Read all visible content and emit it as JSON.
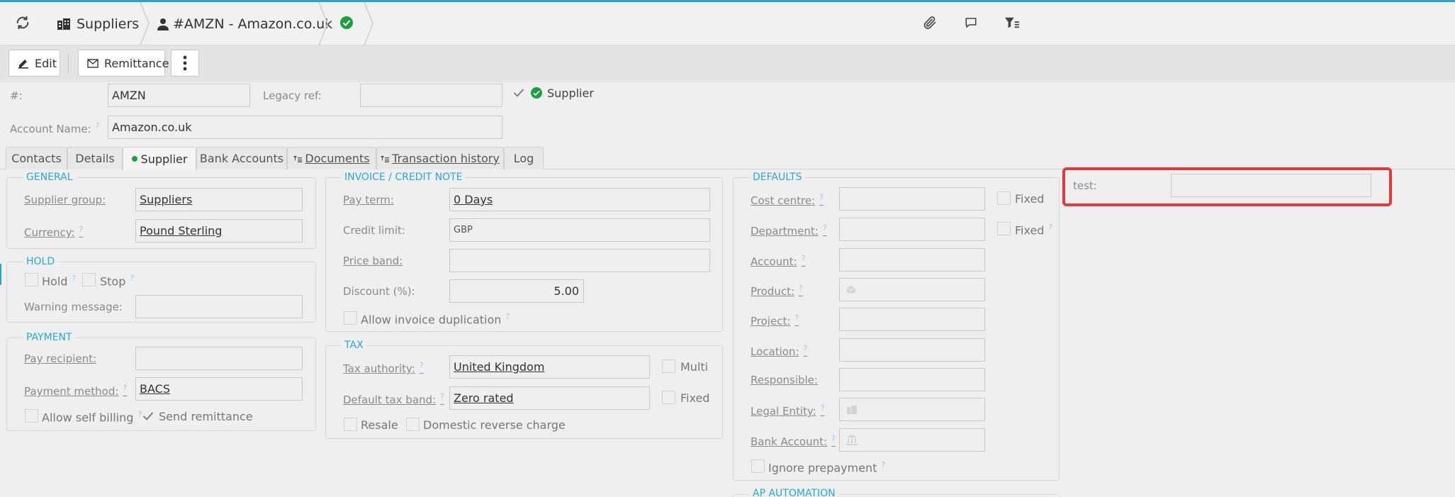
{
  "topbar": {
    "suppliers_label": "Suppliers",
    "record_label": "#AMZN - Amazon.co.uk"
  },
  "toolbar": {
    "edit_label": "Edit",
    "remittance_label": "Remittance"
  },
  "header": {
    "number_label": "#:",
    "number_value": "AMZN",
    "legacy_ref_label": "Legacy ref:",
    "legacy_ref_value": "",
    "supplier_check_label": "Supplier",
    "account_name_label": "Account Name:",
    "account_name_value": "Amazon.co.uk",
    "help_mark": "?"
  },
  "tabs": [
    {
      "label": "Contacts"
    },
    {
      "label": "Details"
    },
    {
      "label": "Supplier"
    },
    {
      "label": "Bank Accounts"
    },
    {
      "label": "Documents"
    },
    {
      "label": "Transaction history"
    },
    {
      "label": "Log"
    }
  ],
  "general": {
    "title": "GENERAL",
    "supplier_group_label": "Supplier group:",
    "supplier_group_value": "Suppliers",
    "currency_label": "Currency:",
    "currency_value": "Pound Sterling"
  },
  "hold": {
    "title": "HOLD",
    "hold_label": "Hold",
    "stop_label": "Stop",
    "warning_label": "Warning message:",
    "warning_value": ""
  },
  "payment": {
    "title": "PAYMENT",
    "pay_recipient_label": "Pay recipient:",
    "pay_recipient_value": "",
    "payment_method_label": "Payment method:",
    "payment_method_value": "BACS",
    "self_billing_label": "Allow self billing",
    "send_remittance_label": "Send remittance"
  },
  "invoice": {
    "title": "INVOICE / CREDIT NOTE",
    "pay_term_label": "Pay term:",
    "pay_term_value": "0 Days",
    "credit_limit_label": "Credit limit:",
    "credit_limit_value": "GBP",
    "price_band_label": "Price band:",
    "price_band_value": "",
    "discount_label": "Discount (%):",
    "discount_value": "5.00",
    "allow_duplication_label": "Allow invoice duplication"
  },
  "tax": {
    "title": "TAX",
    "authority_label": "Tax authority:",
    "authority_value": "United Kingdom",
    "multi_label": "Multi",
    "default_band_label": "Default tax band:",
    "default_band_value": "Zero rated",
    "fixed_label": "Fixed",
    "resale_label": "Resale",
    "domestic_reverse_label": "Domestic reverse charge"
  },
  "defaults": {
    "title": "DEFAULTS",
    "cost_centre_label": "Cost centre:",
    "department_label": "Department:",
    "account_label": "Account:",
    "product_label": "Product:",
    "project_label": "Project:",
    "location_label": "Location:",
    "responsible_label": "Responsible:",
    "legal_entity_label": "Legal Entity:",
    "bank_account_label": "Bank Account:",
    "fixed_label": "Fixed",
    "ignore_prepayment_label": "Ignore prepayment"
  },
  "ap_automation": {
    "title": "AP AUTOMATION"
  },
  "custom": {
    "test_label": "test:",
    "test_value": ""
  },
  "colors": {
    "accent": "#29a3d6",
    "status_green": "#1f9e3f",
    "highlight": "#e03a3a"
  }
}
